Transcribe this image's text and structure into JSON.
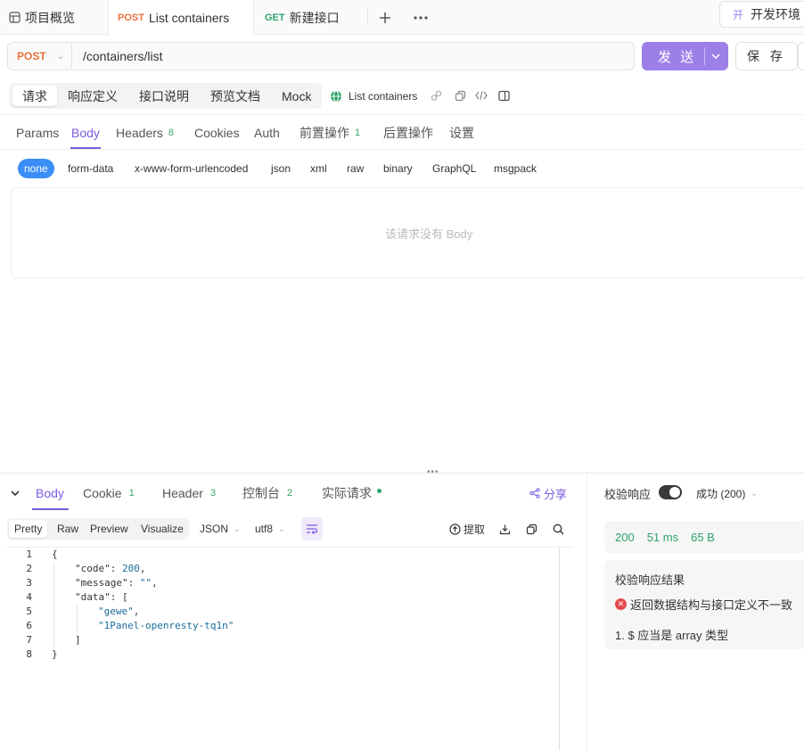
{
  "tabs": [
    {
      "label": "项目概览"
    },
    {
      "method": "POST",
      "label": "List containers"
    },
    {
      "method": "GET",
      "label": "新建接口"
    }
  ],
  "environment": {
    "badge": "开",
    "label": "开发环境"
  },
  "request": {
    "method": "POST",
    "url": "/containers/list",
    "send_label": "发 送",
    "save_label": "保 存"
  },
  "sections": [
    "请求",
    "响应定义",
    "接口说明",
    "预览文档",
    "Mock"
  ],
  "api_name": "List containers",
  "request_tabs": [
    {
      "label": "Params"
    },
    {
      "label": "Body"
    },
    {
      "label": "Headers",
      "count": "8"
    },
    {
      "label": "Cookies"
    },
    {
      "label": "Auth"
    },
    {
      "label": "前置操作",
      "count": "1"
    },
    {
      "label": "后置操作"
    },
    {
      "label": "设置"
    }
  ],
  "body_types": [
    "none",
    "form-data",
    "x-www-form-urlencoded",
    "json",
    "xml",
    "raw",
    "binary",
    "GraphQL",
    "msgpack"
  ],
  "empty_body_text": "该请求没有 Body",
  "response_tabs": [
    {
      "label": "Body"
    },
    {
      "label": "Cookie",
      "count": "1"
    },
    {
      "label": "Header",
      "count": "3"
    },
    {
      "label": "控制台",
      "count": "2"
    },
    {
      "label": "实际请求"
    }
  ],
  "share_label": "分享",
  "format_tabs": [
    "Pretty",
    "Raw",
    "Preview",
    "Visualize"
  ],
  "format_select": "JSON",
  "encoding_select": "utf8",
  "extract_label": "提取",
  "code": {
    "line_numbers": [
      "1",
      "2",
      "3",
      "4",
      "5",
      "6",
      "7",
      "8"
    ],
    "lines": {
      "l1": "{",
      "l2_key": "\"code\"",
      "l2_val": "200",
      "l3_key": "\"message\"",
      "l3_val": "\"\"",
      "l4_key": "\"data\"",
      "l4_val": "[",
      "l5": "\"gewe\"",
      "l6": "\"1Panel-openresty-tq1n\"",
      "l7": "]",
      "l8": "}"
    }
  },
  "validation": {
    "label": "校验响应",
    "enabled": true,
    "status_select": "成功 (200)",
    "stats": {
      "status": "200",
      "time": "51 ms",
      "size": "65 B"
    },
    "result_title": "校验响应结果",
    "error_message": "返回数据结构与接口定义不一致",
    "error_item": "1. $ 应当是 array 类型"
  },
  "colors": {
    "accent": "#7b5ce0",
    "send_button": "#9d7fe8",
    "post_method": "#e8713b",
    "get_method": "#2ea36b",
    "success": "#2ea36b",
    "error": "#e5484d",
    "none_pill": "#3a8ef6"
  }
}
